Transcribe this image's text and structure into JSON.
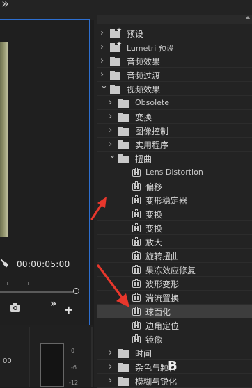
{
  "toolbar": {
    "overflow_icon": "»"
  },
  "program_monitor": {
    "timecode": "00:00:05:00",
    "controls_overflow": "»",
    "add_button": "+"
  },
  "audio_meter": {
    "value_label": "00",
    "scale": [
      "0",
      "-6",
      "-12"
    ]
  },
  "effects_tree": [
    {
      "label": "预设",
      "level": 0,
      "expanded": false,
      "kind": "star-folder"
    },
    {
      "label": "Lumetri 预设",
      "level": 0,
      "expanded": false,
      "kind": "star-folder"
    },
    {
      "label": "音频效果",
      "level": 0,
      "expanded": false,
      "kind": "folder"
    },
    {
      "label": "音频过渡",
      "level": 0,
      "expanded": false,
      "kind": "folder"
    },
    {
      "label": "视频效果",
      "level": 0,
      "expanded": true,
      "kind": "folder"
    },
    {
      "label": "Obsolete",
      "level": 1,
      "expanded": false,
      "kind": "folder"
    },
    {
      "label": "变换",
      "level": 1,
      "expanded": false,
      "kind": "folder"
    },
    {
      "label": "图像控制",
      "level": 1,
      "expanded": false,
      "kind": "folder"
    },
    {
      "label": "实用程序",
      "level": 1,
      "expanded": false,
      "kind": "folder"
    },
    {
      "label": "扭曲",
      "level": 1,
      "expanded": true,
      "kind": "folder"
    },
    {
      "label": "Lens Distortion",
      "level": 2,
      "kind": "effect"
    },
    {
      "label": "偏移",
      "level": 2,
      "kind": "effect"
    },
    {
      "label": "变形稳定器",
      "level": 2,
      "kind": "effect"
    },
    {
      "label": "变换",
      "level": 2,
      "kind": "effect"
    },
    {
      "label": "变换",
      "level": 2,
      "kind": "effect"
    },
    {
      "label": "放大",
      "level": 2,
      "kind": "effect"
    },
    {
      "label": "旋转扭曲",
      "level": 2,
      "kind": "effect"
    },
    {
      "label": "果冻效应修复",
      "level": 2,
      "kind": "effect"
    },
    {
      "label": "波形变形",
      "level": 2,
      "kind": "effect"
    },
    {
      "label": "湍流置换",
      "level": 2,
      "kind": "effect"
    },
    {
      "label": "球面化",
      "level": 2,
      "kind": "effect",
      "selected": true
    },
    {
      "label": "边角定位",
      "level": 2,
      "kind": "effect"
    },
    {
      "label": "镜像",
      "level": 2,
      "kind": "effect"
    },
    {
      "label": "时间",
      "level": 1,
      "expanded": false,
      "kind": "folder"
    },
    {
      "label": "杂色与颗粒",
      "level": 1,
      "expanded": false,
      "kind": "folder"
    },
    {
      "label": "模糊与锐化",
      "level": 1,
      "expanded": false,
      "kind": "folder"
    }
  ],
  "watermark": "B",
  "colors": {
    "panel_bg": "#232323",
    "selected_row": "#3d3d3d",
    "monitor_border": "#2d6fd0",
    "annotation_arrow": "#e8372c"
  }
}
